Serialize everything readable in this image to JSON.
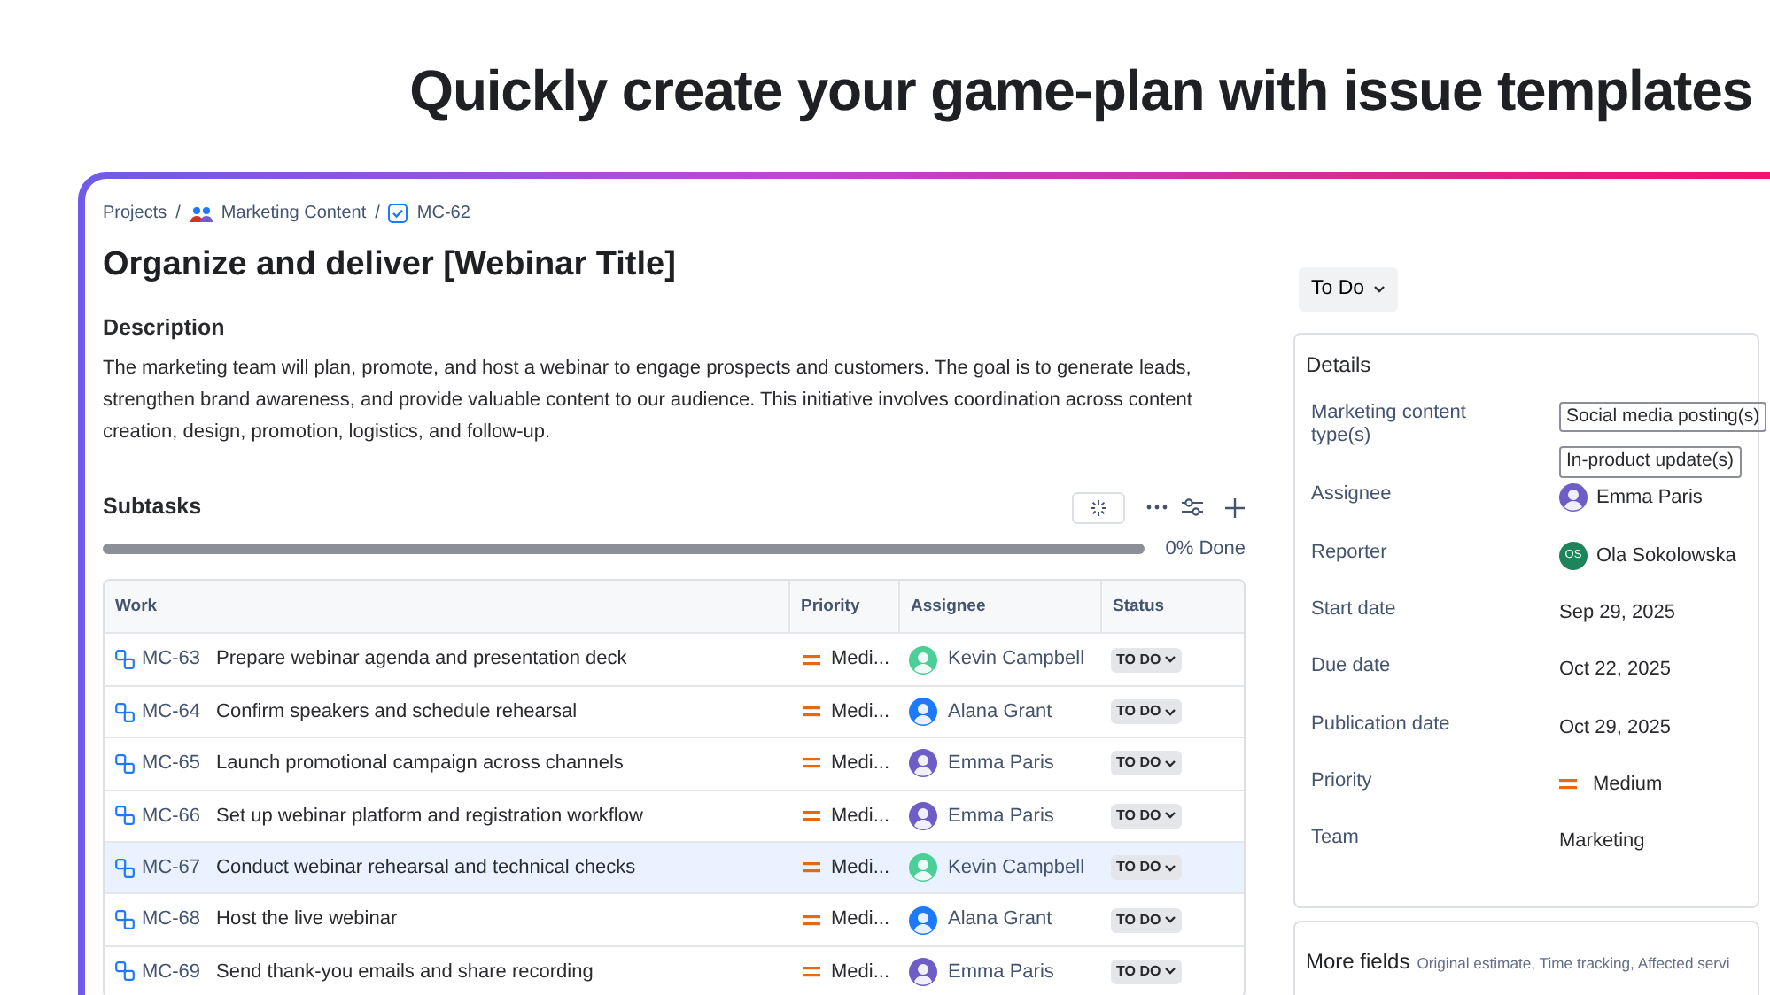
{
  "headline": "Quickly create your game-plan with issue templates",
  "breadcrumb": [
    {
      "label": "Projects",
      "kind": "plain"
    },
    {
      "label": "Marketing Content",
      "kind": "project"
    },
    {
      "label": "MC-62",
      "kind": "issue"
    }
  ],
  "breadcrumb_separator": "/",
  "title": "Organize and deliver [Webinar Title]",
  "description": {
    "heading": "Description",
    "text": "The marketing team will plan, promote, and host a webinar to engage prospects and customers. The goal is to generate leads, strengthen brand awareness, and provide valuable content to our audience. This initiative involves coordination across content creation, design, promotion, logistics, and follow-up."
  },
  "subtasks": {
    "heading": "Subtasks",
    "progress": {
      "level": 0,
      "reading": "0% Done"
    },
    "columns": [
      "Work",
      "Priority",
      "Assignee",
      "Status"
    ],
    "rows": [
      {
        "key": "MC-63",
        "summary": "Prepare webinar agenda and presentation deck",
        "priority": "Medi...",
        "assignee": {
          "name": "Kevin Campbell",
          "color": "#4bce97"
        },
        "status": "TO DO",
        "selected": false
      },
      {
        "key": "MC-64",
        "summary": "Confirm speakers and schedule rehearsal",
        "priority": "Medi...",
        "assignee": {
          "name": "Alana Grant",
          "color": "#1d7afc"
        },
        "status": "TO DO",
        "selected": false
      },
      {
        "key": "MC-65",
        "summary": "Launch promotional campaign across channels",
        "priority": "Medi...",
        "assignee": {
          "name": "Emma Paris",
          "color": "#6e5dc6"
        },
        "status": "TO DO",
        "selected": false
      },
      {
        "key": "MC-66",
        "summary": "Set up webinar platform and registration workflow",
        "priority": "Medi...",
        "assignee": {
          "name": "Emma Paris",
          "color": "#6e5dc6"
        },
        "status": "TO DO",
        "selected": false
      },
      {
        "key": "MC-67",
        "summary": "Conduct webinar rehearsal and technical checks",
        "priority": "Medi...",
        "assignee": {
          "name": "Kevin Campbell",
          "color": "#4bce97"
        },
        "status": "TO DO",
        "selected": true
      },
      {
        "key": "MC-68",
        "summary": "Host the live webinar",
        "priority": "Medi...",
        "assignee": {
          "name": "Alana Grant",
          "color": "#1d7afc"
        },
        "status": "TO DO",
        "selected": false
      },
      {
        "key": "MC-69",
        "summary": "Send thank-you emails and share recording",
        "priority": "Medi...",
        "assignee": {
          "name": "Emma Paris",
          "color": "#6e5dc6"
        },
        "status": "TO DO",
        "selected": false
      }
    ]
  },
  "status_button": "To Do",
  "details": {
    "heading": "Details",
    "fields": [
      {
        "kind": "tags",
        "label": "Marketing content type(s)",
        "values": [
          "Social media posting(s)",
          "In-product update(s)"
        ]
      },
      {
        "kind": "person",
        "label": "Assignee",
        "value": "Emma Paris",
        "color": "#6e5dc6"
      },
      {
        "kind": "initials",
        "label": "Reporter",
        "value": "Ola Sokolowska",
        "initials": "OS",
        "color": "#1f845a"
      },
      {
        "kind": "text",
        "label": "Start date",
        "value": "Sep 29, 2025"
      },
      {
        "kind": "text",
        "label": "Due date",
        "value": "Oct 22, 2025"
      },
      {
        "kind": "text",
        "label": "Publication date",
        "value": "Oct 29, 2025"
      },
      {
        "kind": "priority",
        "label": "Priority",
        "value": "Medium"
      },
      {
        "kind": "text",
        "label": "Team",
        "value": "Marketing"
      }
    ]
  },
  "more_fields": {
    "heading": "More fields",
    "hint": "Original estimate, Time tracking, Affected servi"
  }
}
